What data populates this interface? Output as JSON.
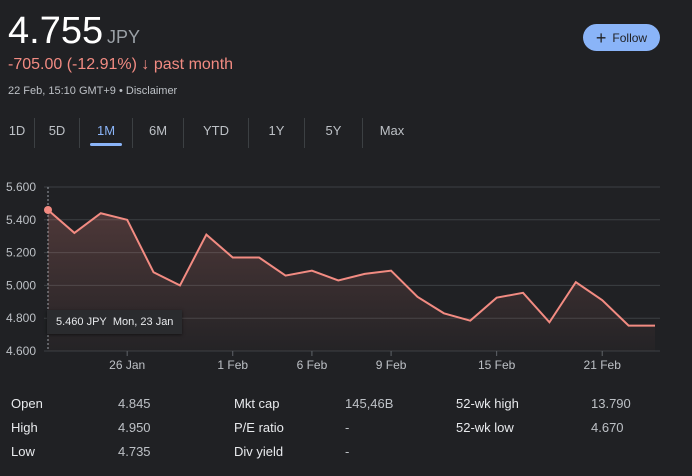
{
  "header": {
    "price": "4.755",
    "currency": "JPY",
    "change": "-705.00 (-12.91%)",
    "change_arrow": "↓",
    "period": "past month",
    "meta": "22 Feb, 15:10 GMT+9 • Disclaimer",
    "follow_label": "Follow",
    "follow_icon": "plus-icon"
  },
  "tabs": [
    {
      "label": "1D"
    },
    {
      "label": "5D"
    },
    {
      "label": "1M",
      "active": true
    },
    {
      "label": "6M"
    },
    {
      "label": "YTD"
    },
    {
      "label": "1Y"
    },
    {
      "label": "5Y"
    },
    {
      "label": "Max"
    }
  ],
  "tooltip": {
    "value": "5.460 JPY",
    "date": "Mon, 23 Jan"
  },
  "colors": {
    "line": "#f28b82",
    "accent": "#8ab4f8"
  },
  "chart_data": {
    "type": "area",
    "ylim": [
      4.6,
      5.6
    ],
    "yticks": [
      "4.600",
      "4.800",
      "5.000",
      "5.200",
      "5.400",
      "5.600"
    ],
    "ytick_values": [
      4.6,
      4.8,
      5.0,
      5.2,
      5.4,
      5.6
    ],
    "xticks": [
      {
        "label": "26 Jan",
        "index": 3
      },
      {
        "label": "1 Feb",
        "index": 7
      },
      {
        "label": "6 Feb",
        "index": 10
      },
      {
        "label": "9 Feb",
        "index": 13
      },
      {
        "label": "15 Feb",
        "index": 17
      },
      {
        "label": "21 Feb",
        "index": 21
      }
    ],
    "values": [
      5.46,
      5.32,
      5.44,
      5.4,
      5.08,
      5.0,
      5.31,
      5.17,
      5.17,
      5.06,
      5.09,
      5.03,
      5.07,
      5.09,
      4.93,
      4.83,
      4.785,
      4.925,
      4.955,
      4.775,
      5.02,
      4.91,
      4.755,
      4.755
    ],
    "grid": true
  },
  "stats": [
    {
      "label": "Open",
      "value": "4.845"
    },
    {
      "label": "High",
      "value": "4.950"
    },
    {
      "label": "Low",
      "value": "4.735"
    },
    {
      "label": "Mkt cap",
      "value": "145,46B"
    },
    {
      "label": "P/E ratio",
      "value": "-"
    },
    {
      "label": "Div yield",
      "value": "-"
    },
    {
      "label": "52-wk high",
      "value": "13.790"
    },
    {
      "label": "52-wk low",
      "value": "4.670"
    }
  ]
}
